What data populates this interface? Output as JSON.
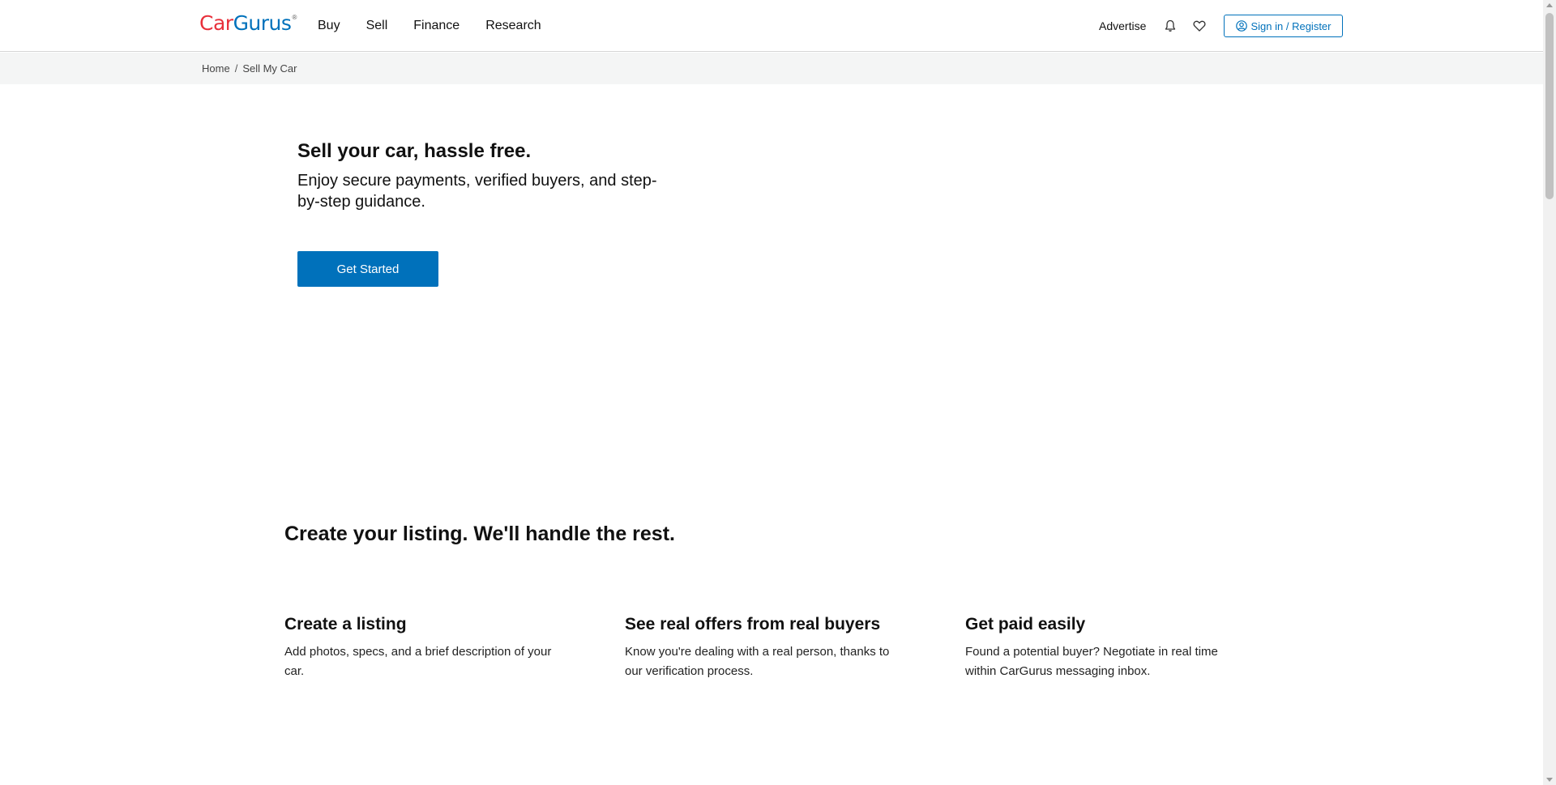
{
  "header": {
    "logo_car": "Car",
    "logo_gurus": "Gurus",
    "logo_reg": "®",
    "nav": [
      "Buy",
      "Sell",
      "Finance",
      "Research"
    ],
    "advertise": "Advertise",
    "bell_icon": "bell-icon",
    "heart_icon": "heart-icon",
    "signin": "Sign in / Register"
  },
  "breadcrumb": {
    "home": "Home",
    "separator": "/",
    "current": "Sell My Car"
  },
  "hero": {
    "title": "Sell your car, hassle free.",
    "subtitle": "Enjoy secure payments, verified buyers, and step-by-step guidance.",
    "cta": "Get Started"
  },
  "section": {
    "title": "Create your listing. We'll handle the rest.",
    "steps": [
      {
        "title": "Create a listing",
        "desc": "Add photos, specs, and a brief description of your car."
      },
      {
        "title": "See real offers from real buyers",
        "desc": "Know you're dealing with a real person, thanks to our verification process."
      },
      {
        "title": "Get paid easily",
        "desc": "Found a potential buyer? Negotiate in real time within CarGurus messaging inbox."
      }
    ]
  },
  "colors": {
    "brand_blue": "#0071bb",
    "brand_red": "#e8303b",
    "crumb_bg": "#f4f5f5"
  }
}
